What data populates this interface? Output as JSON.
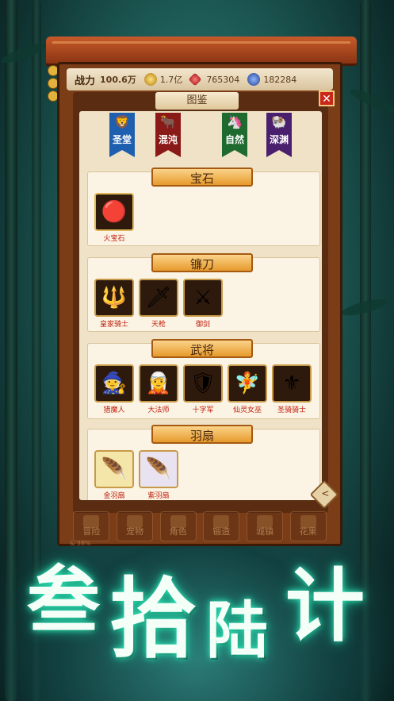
{
  "topbar": {
    "power_label": "战力",
    "power_value": "100.6万",
    "gold": "1.7亿",
    "gems": "765304",
    "jade": "182284"
  },
  "panel": {
    "title": "图鉴",
    "close": "✕"
  },
  "factions": [
    {
      "name": "圣堂",
      "color": "#1f5fb0",
      "icon": "🦁"
    },
    {
      "name": "混沌",
      "color": "#8a1a18",
      "icon": "🐂"
    },
    {
      "name": "自然",
      "color": "#1f6a2e",
      "icon": "🦄"
    },
    {
      "name": "深渊",
      "color": "#4a1f6e",
      "icon": "🐏"
    }
  ],
  "sections": [
    {
      "title": "宝石",
      "items": [
        {
          "label": "火宝石",
          "icon": "🔴"
        }
      ]
    },
    {
      "title": "镰刀",
      "items": [
        {
          "label": "皇家骑士",
          "icon": "🔱"
        },
        {
          "label": "天枪",
          "icon": "🗡"
        },
        {
          "label": "御剑",
          "icon": "⚔"
        }
      ]
    },
    {
      "title": "武将",
      "items": [
        {
          "label": "猎魔人",
          "icon": "🧙"
        },
        {
          "label": "大法师",
          "icon": "🧝"
        },
        {
          "label": "十字军",
          "icon": "🛡"
        },
        {
          "label": "仙灵女巫",
          "icon": "🧚"
        },
        {
          "label": "圣骑骑士",
          "icon": "⚜"
        }
      ]
    },
    {
      "title": "羽扇",
      "items": [
        {
          "label": "金羽扇",
          "icon": "🪶"
        },
        {
          "label": "紫羽扇",
          "icon": "🪶"
        }
      ]
    }
  ],
  "bottom_nav": [
    "冒险",
    "宠物",
    "角色",
    "锻造",
    "城镇",
    "花果"
  ],
  "footer": "& 38%",
  "title_chars": [
    "叁",
    "拾",
    "陆",
    "计"
  ]
}
